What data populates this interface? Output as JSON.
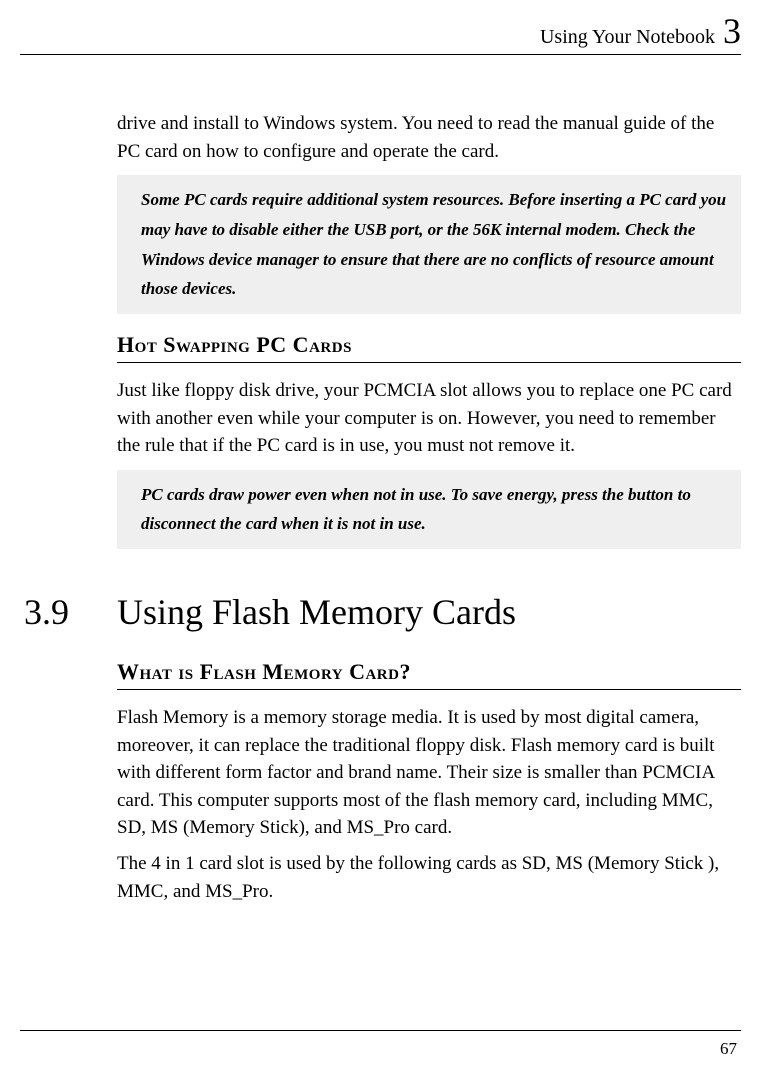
{
  "header": {
    "title": "Using Your Notebook",
    "chapter": "3"
  },
  "intro_para": "drive and install to Windows system. You need to read the manual guide of the PC card on how to configure and operate the card.",
  "note1": "Some PC cards require additional system resources. Before inserting a PC card you may have to disable either the USB port, or the 56K internal modem. Check the Windows device manager to ensure that there are no conflicts of resource amount those devices.",
  "subheading1": "Hot Swapping PC Cards",
  "para1": "Just like floppy disk drive, your PCMCIA slot allows you to replace one PC card with another even while your computer is on. However, you need to remember the rule that if the PC card is in use, you must not remove it.",
  "note2": "PC cards draw power even when not in use. To save energy, press the button to disconnect the card when it is not in use.",
  "section": {
    "num": "3.9",
    "title": "Using Flash Memory Cards"
  },
  "subheading2": "What is Flash Memory Card?",
  "para2": "Flash Memory is a memory storage media. It is used by most digital camera, moreover, it can replace the traditional floppy disk. Flash memory card is built with different form factor and brand name. Their size is smaller than PCMCIA card. This computer supports most of the flash memory card, including MMC, SD, MS (Memory Stick), and MS_Pro card.",
  "para3": "The 4 in 1 card slot is used by the following cards as SD, MS (Memory Stick ), MMC, and MS_Pro.",
  "page_num": "67"
}
